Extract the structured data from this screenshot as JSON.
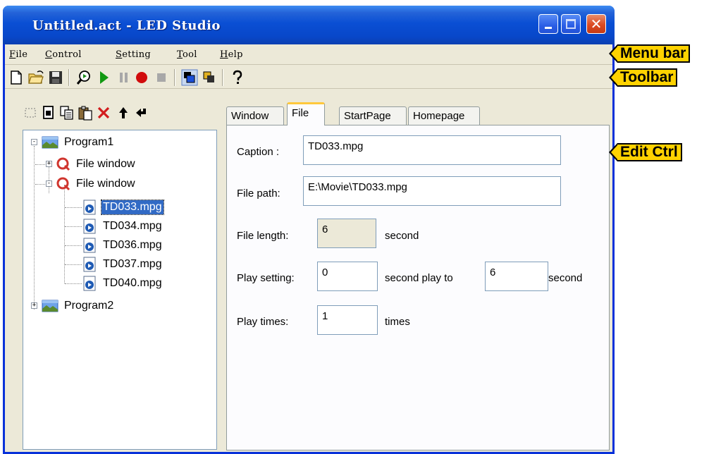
{
  "window": {
    "title": "Untitled.act - LED Studio"
  },
  "menu": [
    "File",
    "Control",
    "Setting",
    "Tool",
    "Help"
  ],
  "toolbar_icons": [
    "new-icon",
    "open-icon",
    "save-icon",
    "preview-icon",
    "play-icon",
    "pause-icon",
    "record-icon",
    "stop-icon",
    "window-front-icon",
    "window-back-icon",
    "help-icon"
  ],
  "left_toolbar_icons": [
    "select-icon",
    "copy-page-icon",
    "copy-icon",
    "paste-icon",
    "delete-icon",
    "move-up-icon",
    "move-down-icon"
  ],
  "tree": {
    "program1": "Program1",
    "file_window_1": "File window",
    "file_window_2": "File window",
    "files": [
      "TD033.mpg",
      "TD034.mpg",
      "TD036.mpg",
      "TD037.mpg",
      "TD040.mpg"
    ],
    "program2": "Program2"
  },
  "tabs": [
    "Window",
    "File",
    "StartPage",
    "Homepage"
  ],
  "form": {
    "caption_label": "Caption :",
    "caption_value": "TD033.mpg",
    "filepath_label": "File path:",
    "filepath_value": "E:\\Movie\\TD033.mpg",
    "filelength_label": "File length:",
    "filelength_value": "6",
    "filelength_unit": "second",
    "play_setting_label": "Play setting:",
    "play_from_value": "0",
    "play_to_text": "second play to",
    "play_to_value": "6",
    "play_to_unit": "second",
    "play_times_label": "Play times:",
    "play_times_value": "1",
    "play_times_unit": "times"
  },
  "callouts": {
    "menubar": "Menu bar",
    "toolbar": "Toolbar",
    "editctrl": "Edit Ctrl"
  },
  "colors": {
    "title_bar": "#0a4fd4",
    "selection": "#316ac5",
    "callout": "#ffd200",
    "active_tab": "#ffc83c"
  }
}
